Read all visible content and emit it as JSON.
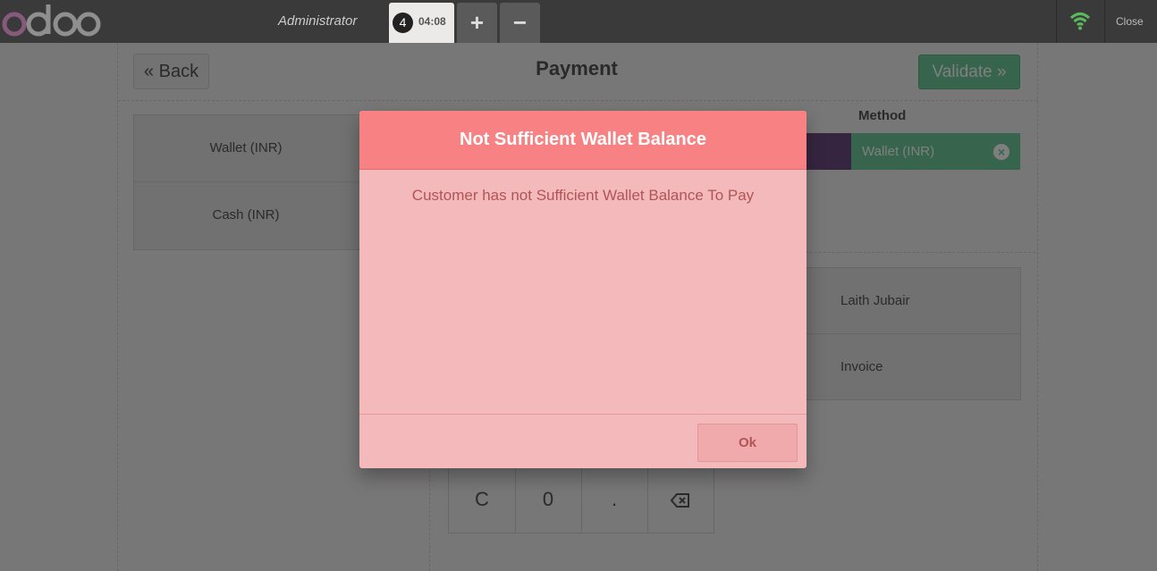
{
  "header": {
    "cashier": "Administrator",
    "order_tab": {
      "sequence": "4",
      "time": "04:08"
    },
    "add_order_label": "+",
    "remove_order_label": "−",
    "close_label": "Close",
    "wifi_icon": "wifi-icon",
    "wifi_color": "#5cb85c"
  },
  "payment": {
    "back_label": "Back",
    "title": "Payment",
    "validate_label": "Validate",
    "methods": [
      "Wallet (INR)",
      "Cash (INR)"
    ],
    "method_header": "Method",
    "paymentline_method": "Wallet (INR)",
    "side_buttons": [
      "Laith Jubair",
      "Invoice"
    ],
    "numpad_keys": [
      "C",
      "0",
      "."
    ],
    "accent_green": "#6ec89b"
  },
  "dialog": {
    "title": "Not Sufficient Wallet Balance",
    "body": "Customer has not Sufficient Wallet Balance To Pay",
    "ok_label": "Ok",
    "header_color": "#f88283",
    "body_color": "#f4b9ba"
  }
}
